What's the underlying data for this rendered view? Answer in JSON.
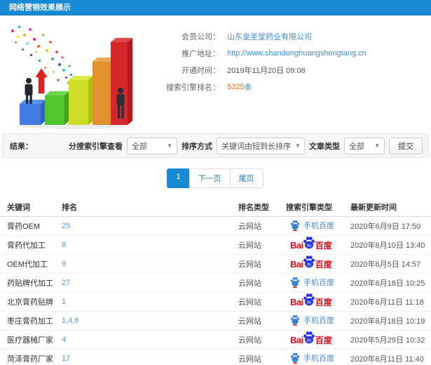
{
  "header": {
    "title": "网络营销效果展示"
  },
  "info": {
    "fields": [
      {
        "label": "会员公司：",
        "value": "山东皇圣堂药业有限公司"
      },
      {
        "label": "推广地址：",
        "value": "http://www.shandonghuangshengtang.cn"
      },
      {
        "label": "开通时间：",
        "value": "2019年11月20日 09:08"
      },
      {
        "label": "搜索引擎排名：",
        "value": "5325",
        "suffix": "条"
      }
    ]
  },
  "filter": {
    "result_label": "结果：",
    "engine_view_label": "分搜索引擎查看",
    "engine_view_value": "全部",
    "sort_label": "排序方式",
    "sort_value": "关键词由短到长排序",
    "article_type_label": "文章类型",
    "article_type_value": "全部",
    "submit_label": "提交",
    "caret": "▼"
  },
  "pagination": {
    "current": "1",
    "next_label": "下一页",
    "last_label": "尾页"
  },
  "table": {
    "columns": [
      "关键词",
      "排名",
      "排名类型",
      "搜索引擎类型",
      "最新更新时间"
    ],
    "rows": [
      {
        "keyword": "膏药OEM",
        "rank": "25",
        "rank_type": "云网站",
        "engine": "mobile-baidu",
        "time": "2020年6月9日 17:50"
      },
      {
        "keyword": "膏药代加工",
        "rank": "8",
        "rank_type": "云网站",
        "engine": "baidu",
        "time": "2020年6月10日 13:40"
      },
      {
        "keyword": "OEM代加工",
        "rank": "9",
        "rank_type": "云网站",
        "engine": "baidu",
        "time": "2020年6月5日 14:57"
      },
      {
        "keyword": "药贴牌代加工",
        "rank": "27",
        "rank_type": "云网站",
        "engine": "mobile-baidu",
        "time": "2020年6月18日 10:25"
      },
      {
        "keyword": "北京膏药贴牌",
        "rank": "1",
        "rank_type": "云网站",
        "engine": "baidu",
        "time": "2020年6月11日 11:18"
      },
      {
        "keyword": "枣庄膏药加工",
        "rank": "1,4,6",
        "rank_type": "云网站",
        "engine": "mobile-baidu",
        "time": "2020年6月18日 10:19"
      },
      {
        "keyword": "医疗器械厂家",
        "rank": "4",
        "rank_type": "云网站",
        "engine": "baidu",
        "time": "2020年5月29日 10:32"
      },
      {
        "keyword": "菏泽膏药厂家",
        "rank": "17",
        "rank_type": "云网站",
        "engine": "mobile-baidu",
        "time": "2020年6月11日 11:40"
      }
    ]
  },
  "brands": {
    "baidu": {
      "part1": "Bai",
      "du": "du",
      "part2": "百度"
    },
    "mobile_baidu": {
      "label": "手机百度"
    }
  },
  "colors": {
    "accent_blue": "#1789d5",
    "link_blue": "#3f8fd2",
    "rank_blue": "#4f9bd3",
    "highlight_orange": "#ff6600",
    "baidu_red": "#dc0a18",
    "baidu_paw_blue": "#2633df",
    "mobile_paw_blue": "#3b82d4"
  }
}
